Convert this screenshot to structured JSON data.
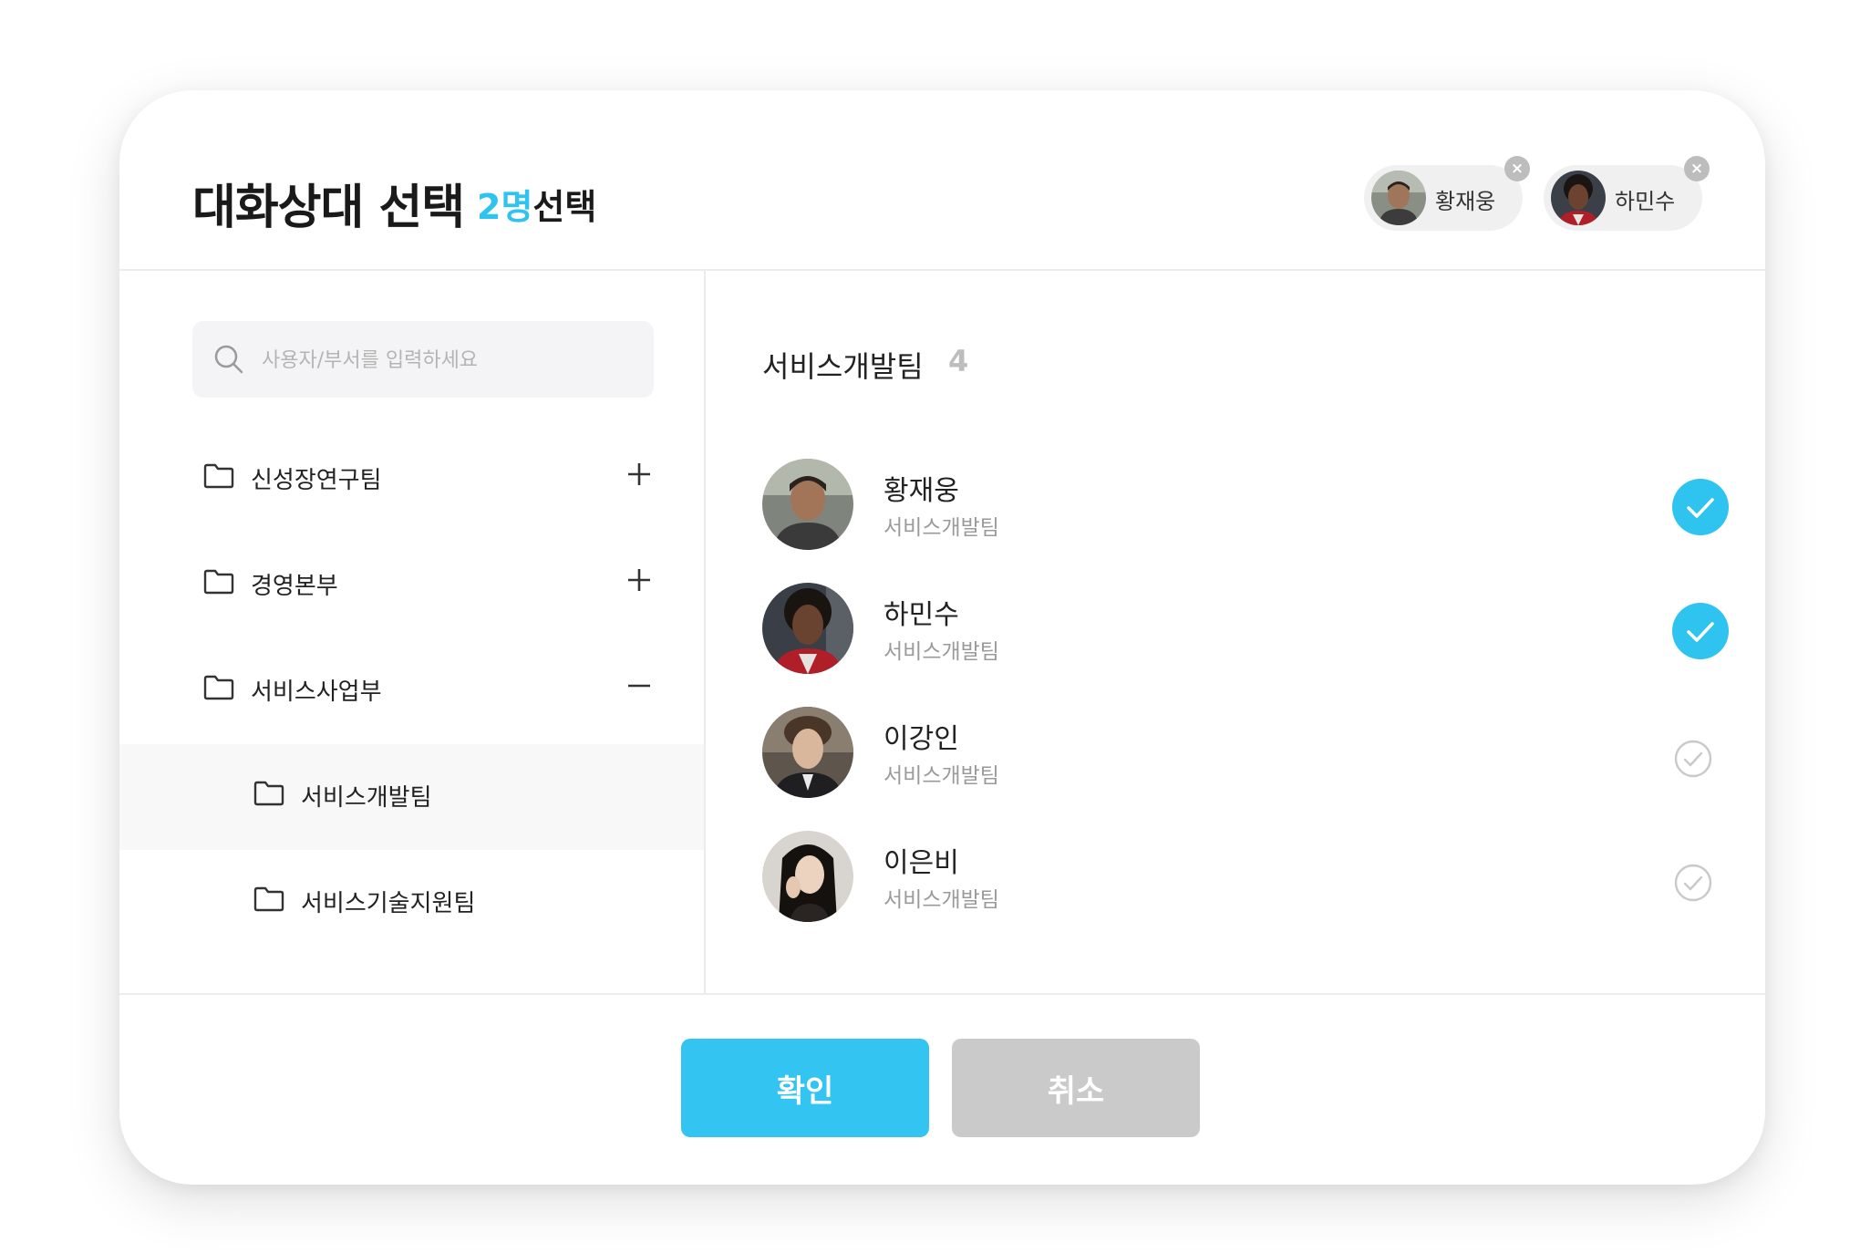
{
  "header": {
    "title": "대화상대 선택",
    "selected_count": "2명",
    "selected_suffix": "선택",
    "chips": [
      {
        "name": "황재웅",
        "avatar_icon": "profile-photo"
      },
      {
        "name": "하민수",
        "avatar_icon": "profile-photo"
      }
    ]
  },
  "search": {
    "placeholder": "사용자/부서를 입력하세요",
    "value": ""
  },
  "tree": {
    "items": [
      {
        "label": "신성장연구팀",
        "icon": "folder-icon",
        "toggle": "plus"
      },
      {
        "label": "경영본부",
        "icon": "folder-icon",
        "toggle": "plus"
      },
      {
        "label": "서비스사업부",
        "icon": "folder-icon",
        "toggle": "minus"
      },
      {
        "label": "서비스개발팀",
        "icon": "folder-icon",
        "selected": true
      },
      {
        "label": "서비스기술지원팀",
        "icon": "folder-icon"
      }
    ]
  },
  "group": {
    "title": "서비스개발팀",
    "count": "4"
  },
  "members": [
    {
      "name": "황재웅",
      "dept": "서비스개발팀",
      "checked": true
    },
    {
      "name": "하민수",
      "dept": "서비스개발팀",
      "checked": true
    },
    {
      "name": "이강인",
      "dept": "서비스개발팀",
      "checked": false
    },
    {
      "name": "이은비",
      "dept": "서비스개발팀",
      "checked": false
    }
  ],
  "footer": {
    "confirm_label": "확인",
    "cancel_label": "취소"
  },
  "colors": {
    "accent": "#2fc3ef",
    "cancel_bg": "#cacaca"
  }
}
